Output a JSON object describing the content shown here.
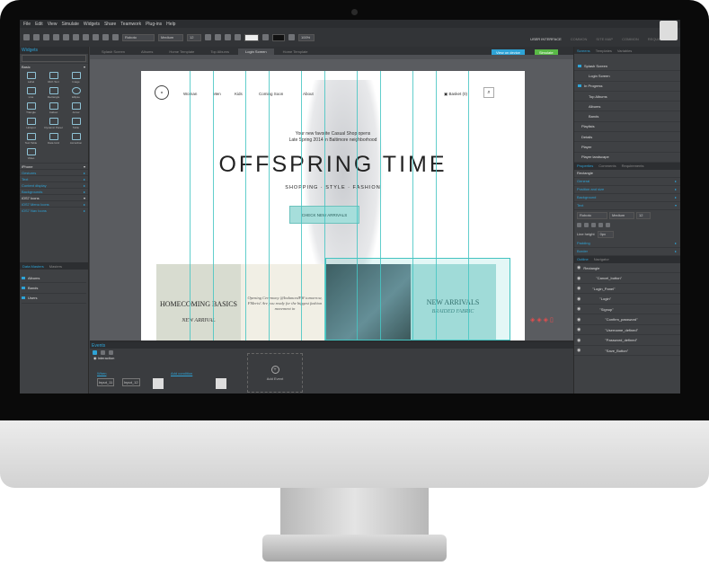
{
  "menu": [
    "File",
    "Edit",
    "View",
    "Simulate",
    "Widgets",
    "Share",
    "Teamwork",
    "Plug-ins",
    "Help"
  ],
  "toolbar": {
    "font": "Roboto",
    "weight": "Medium",
    "size": "12",
    "zoom": "100%"
  },
  "layout_tabs": [
    "USER INTERFACE",
    "COMMON",
    "SITE MAP",
    "COMMON",
    "REQUIREMENTS"
  ],
  "left": {
    "widgets_title": "Widgets",
    "basic": "Basic",
    "widgets": [
      "Label",
      "Rich Text",
      "Image",
      "Line",
      "Rectangle",
      "Ellipse",
      "Triangle",
      "Callout",
      "Arrow",
      "Hotspot",
      "Dynamic Panel",
      "Table",
      "Text Table",
      "Data Grid",
      "Accordion",
      "Video"
    ],
    "categories": [
      "iPhone",
      "Gestures",
      "Text",
      "Content display",
      "Backgrounds",
      "iOS7 Icons",
      "iOS7 Menu Icons",
      "iOS7 Nav Icons"
    ],
    "data_tab": "Data Masters",
    "masters_tab": "Masters",
    "data_items": [
      "Albums",
      "Bands",
      "Users"
    ]
  },
  "doc_tabs": [
    "Splash Screen",
    "Albums",
    "Home Template",
    "Top Albums",
    "Login Screen",
    "Home Template"
  ],
  "controls": {
    "view_device": "View on device",
    "simulate": "Simulate"
  },
  "page": {
    "nav": [
      "Woman",
      "Men",
      "Kids",
      "Coming Soon",
      "About"
    ],
    "basket": "Basket (0)",
    "tag1": "Your new favorite Casual Shop opens",
    "tag2": "Late Spring 2014 in Baltimore neighborhood",
    "headline": "OFFSPRING TIME",
    "sub": "SHOPPING · STYLE · FASHION",
    "cta": "CHECK NEW ARRIVALS",
    "h1": "HOMECOMING BASICS",
    "h1s": "NEW ARRIVAL",
    "quote": "Opening Ceremony @IndancedFW tomorrow, FMeris! Are you ready for the biggest fashion movement in",
    "h2": "NEW ARRIVALS",
    "h2s": "BRAIDED FABRIC"
  },
  "events": {
    "title": "Events",
    "name": "Interaction",
    "when": "When",
    "add_condition": "Add condition",
    "input1": "Input_11",
    "input2": "Input_12",
    "add_event": "Add Event"
  },
  "right": {
    "tabs": [
      "Screens",
      "Templates",
      "Variables"
    ],
    "screens": [
      "Splash Screen",
      "Login Screen",
      "In Progress",
      "Top Albums",
      "Albums",
      "Bands",
      "Playlists",
      "Details",
      "Player",
      "Player landscape"
    ],
    "prop_tabs": [
      "Properties",
      "Comments",
      "Requirements"
    ],
    "props": [
      "Rectangle",
      "General",
      "Position and size",
      "Background",
      "Text",
      "Padding",
      "Border"
    ],
    "font": "Roboto",
    "weight": "Medium",
    "size": "12",
    "line_height": "Line height",
    "lh_value": "0px",
    "outline_tabs": [
      "Outline",
      "Navigator"
    ],
    "outline": [
      "Rectangle",
      "\"Cancel_button\"",
      "\"Login_Panel\"",
      "\"Login\"",
      "\"Signup\"",
      "\"Confirm_password\"",
      "\"Username_defined\"",
      "\"Password_defined\"",
      "\"Save_Button\""
    ]
  },
  "colors": {
    "accent": "#2ea3d6",
    "guide": "#46c6c3",
    "simulate": "#59b946",
    "device": "#2ea3d6"
  }
}
